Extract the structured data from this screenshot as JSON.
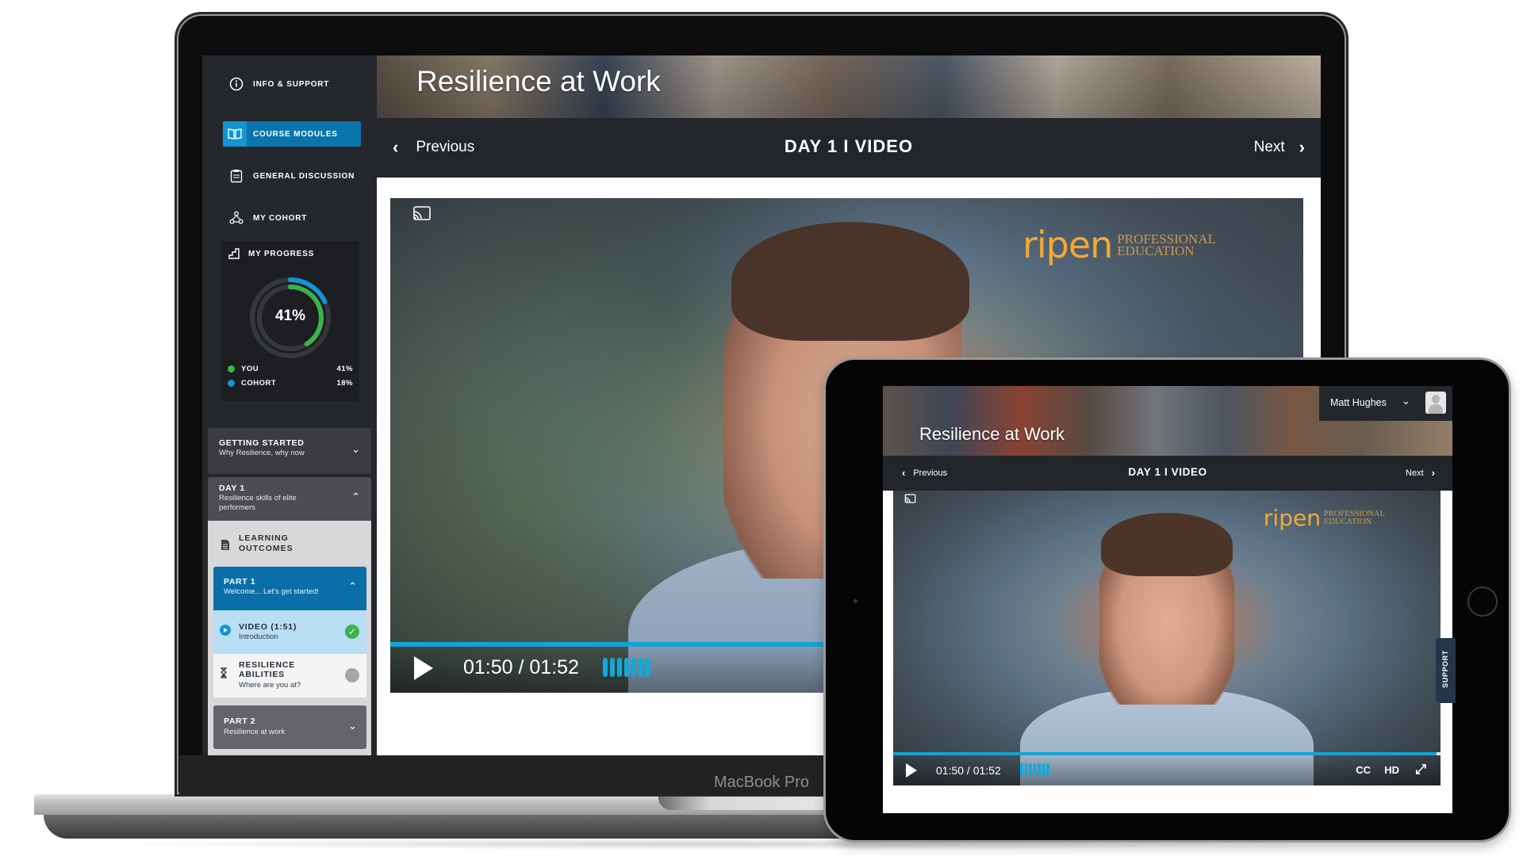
{
  "laptop": {
    "device_label": "MacBook Pro",
    "sidebar": {
      "nav_items": [
        {
          "label": "INFO & SUPPORT",
          "icon": "info-icon",
          "active": false
        },
        {
          "label": "COURSE MODULES",
          "icon": "book-icon",
          "active": true
        },
        {
          "label": "GENERAL DISCUSSION",
          "icon": "discussion-icon",
          "active": false
        },
        {
          "label": "MY COHORT",
          "icon": "cohort-icon",
          "active": false
        }
      ],
      "progress": {
        "title": "MY PROGRESS",
        "icon": "stairs-icon",
        "center_label": "41%",
        "you": {
          "label": "YOU",
          "value": "41%",
          "fraction": 0.41,
          "color": "#3cb34a"
        },
        "cohort": {
          "label": "COHORT",
          "value": "18%",
          "fraction": 0.18,
          "color": "#1394d3"
        }
      },
      "modules": [
        {
          "title": "GETTING STARTED",
          "subtitle": "Why Resilience, why now",
          "expanded": false
        },
        {
          "title": "DAY 1",
          "subtitle": "Resilience skills of elite performers",
          "expanded": true,
          "items": {
            "learning_outcomes": "LEARNING OUTCOMES",
            "part1": {
              "title": "PART 1",
              "subtitle": "Welcome... Let's get started!",
              "expanded": true,
              "lessons": [
                {
                  "title": "VIDEO (1:51)",
                  "subtitle": "Introduction",
                  "status": "complete"
                },
                {
                  "title": "RESILIENCE ABILITIES",
                  "subtitle": "Where are you at?",
                  "status": "pending"
                }
              ]
            },
            "part2": {
              "title": "PART 2",
              "subtitle": "Resilience at work",
              "expanded": false
            }
          }
        }
      ]
    },
    "header": {
      "course_title": "Resilience at Work",
      "prev_label": "Previous",
      "next_label": "Next",
      "page_title": "DAY 1 I VIDEO"
    },
    "video": {
      "brand": "ripen",
      "brand_line1": "PROFESSIONAL",
      "brand_line2": "EDUCATION",
      "timecode": "01:50 / 01:52",
      "progress_fraction": 0.98
    }
  },
  "tablet": {
    "course_title": "Resilience at Work",
    "user_name": "Matt Hughes",
    "prev_label": "Previous",
    "next_label": "Next",
    "page_title": "DAY 1 I VIDEO",
    "video": {
      "brand": "ripen",
      "brand_line1": "PROFESSIONAL",
      "brand_line2": "EDUCATION",
      "timecode": "01:50 / 01:52",
      "progress_fraction": 0.99,
      "cc_label": "CC",
      "hd_label": "HD"
    },
    "support_label": "SUPPORT"
  },
  "colors": {
    "accent": "#0a74ad",
    "player_blue": "#11a5d2",
    "brand_orange": "#f2a935",
    "sidebar_bg": "#24272b",
    "complete_green": "#3cb34a"
  }
}
